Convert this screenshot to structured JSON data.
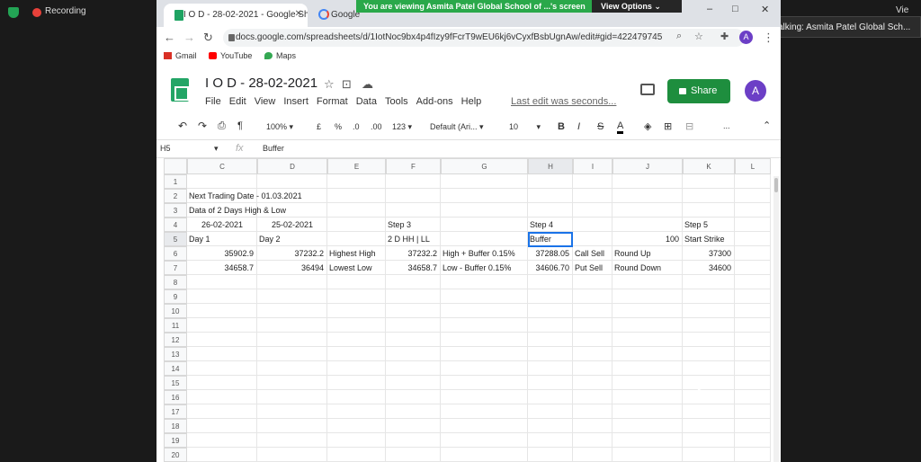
{
  "zoom": {
    "recording_label": "Recording",
    "view_label": "Vie",
    "talking_label": "Talking: Asmita Patel Global Sch...",
    "banner_text": "You are viewing Asmita Patel Global School of ...'s screen",
    "view_options": "View Options ⌄"
  },
  "browser": {
    "tabs": [
      {
        "label": "I O D - 28-02-2021 - Google Sh"
      },
      {
        "label": "Google"
      }
    ],
    "url": "docs.google.com/spreadsheets/d/1IotNoc9bx4p4fIzy9fFcrT9wEU6kj6vCyxfBsbUgnAw/edit#gid=422479745",
    "bookmarks": [
      "Gmail",
      "YouTube",
      "Maps"
    ],
    "profile_initial": "A"
  },
  "sheets": {
    "title": "I O D - 28-02-2021",
    "menus": [
      "File",
      "Edit",
      "View",
      "Insert",
      "Format",
      "Data",
      "Tools",
      "Add-ons",
      "Help"
    ],
    "last_edit": "Last edit was seconds...",
    "share_label": "Share",
    "avatar_initial": "A",
    "toolbar": {
      "zoom": "100%",
      "currency": "£",
      "percent": "%",
      "dec_less": ".0",
      "dec_more": ".00",
      "format": "123",
      "font": "Default (Ari...",
      "font_size": "10",
      "bold": "B",
      "italic": "I",
      "strike": "S",
      "text_color": "A",
      "more": "..."
    },
    "name_box": "H5",
    "fx_label": "fx",
    "formula_value": "Buffer",
    "columns": [
      "C",
      "D",
      "E",
      "F",
      "G",
      "H",
      "I",
      "J",
      "K",
      "L"
    ],
    "rows": [
      "1",
      "2",
      "3",
      "4",
      "5",
      "6",
      "7",
      "8",
      "9",
      "10",
      "11",
      "12",
      "13",
      "14",
      "15",
      "16",
      "17",
      "18",
      "19",
      "20"
    ],
    "cells": {
      "r2": "Next Trading Date - 01.03.2021",
      "r3": "Data of 2 Days High & Low",
      "r4": {
        "C": "26-02-2021",
        "D": "25-02-2021",
        "F": "Step 3",
        "H": "Step 4",
        "K": "Step 5"
      },
      "r5": {
        "C": "Day 1",
        "D": "Day 2",
        "F": "2 D HH | LL",
        "H": "Buffer",
        "J": "100",
        "K": "Start Strike"
      },
      "r6": {
        "C": "35902.9",
        "D": "37232.2",
        "E": "Highest High",
        "F": "37232.2",
        "G": "High + Buffer 0.15%",
        "H": "37288.05",
        "I": "Call Sell",
        "J": "Round Up",
        "K": "37300"
      },
      "r7": {
        "C": "34658.7",
        "D": "36494",
        "E": "Lowest Low",
        "F": "34658.7",
        "G": "Low - Buffer 0.15%",
        "H": "34606.70",
        "I": "Put Sell",
        "J": "Round Down",
        "K": "34600"
      }
    }
  }
}
